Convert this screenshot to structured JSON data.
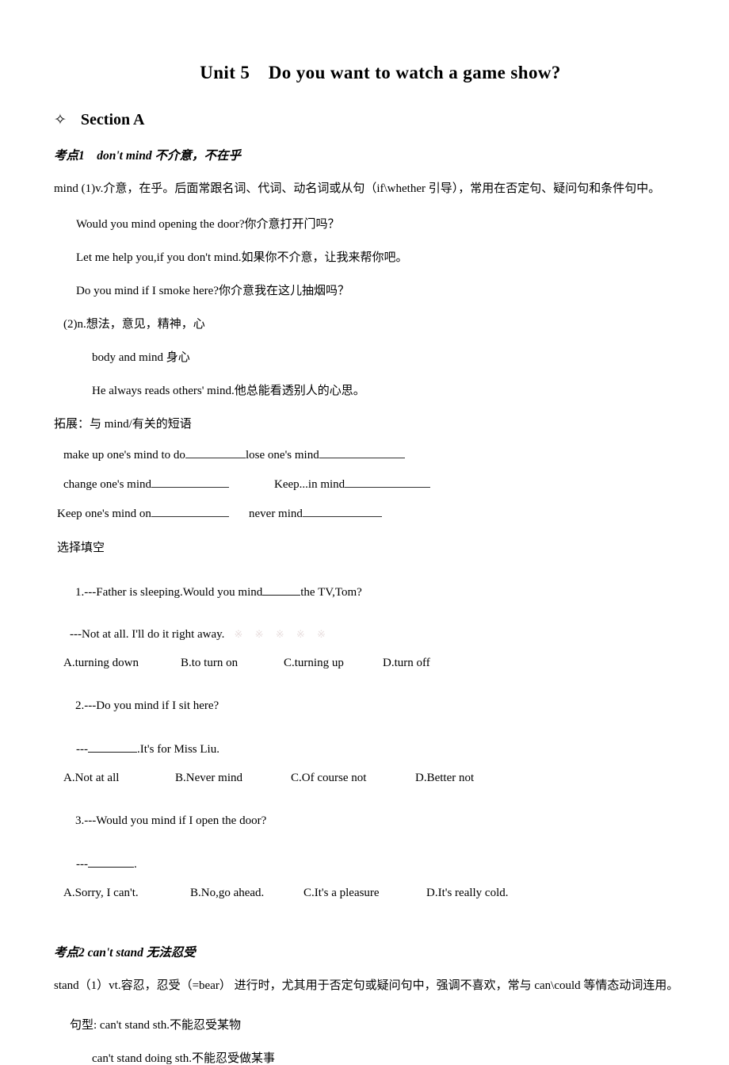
{
  "document": {
    "title": "Unit 5　Do you want to watch a game show?",
    "section_heading": {
      "bullet_icon": "diamond-star-icon",
      "bullet_glyph": "✧",
      "label": "Section A"
    }
  },
  "point1": {
    "heading": "考点1　don't mind 不介意，不在乎",
    "definition_1": "mind (1)v.介意，在乎。后面常跟名词、代词、动名词或从句（if\\whether 引导），常用在否定句、疑问句和条件句中。",
    "examples_1": [
      "Would you mind opening the door?你介意打开门吗？",
      "Let me help you,if you don't mind.如果你不介意，让我来帮你吧。",
      "Do you mind if I smoke here?你介意我在这儿抽烟吗？"
    ],
    "definition_2": "(2)n.想法，意见，精神，心",
    "examples_2": [
      "body and mind 身心",
      "He always reads others' mind.他总能看透别人的心思。"
    ],
    "expansion_label": "拓展：与 mind/有关的短语",
    "phrases": [
      {
        "left": "make up one's mind to do",
        "right": "lose one's mind"
      },
      {
        "left": "change one's mind",
        "right": "Keep...in mind"
      },
      {
        "left": "Keep one's mind on",
        "right": "never mind"
      }
    ],
    "exercise_label": "选择填空",
    "questions": [
      {
        "number": "1.",
        "prompt_before": "1.---Father is sleeping.Would you mind",
        "prompt_after": "the TV,Tom?",
        "answer_line": "---Not at all. I'll do it right away.",
        "watermark": "※ ※ ※ ※ ※",
        "options": [
          "A.turning down",
          "B.to turn on",
          "C.turning up",
          "D.turn off"
        ]
      },
      {
        "number": "2.",
        "prompt_before": "2.---Do you mind if I sit here?",
        "prompt_after": "",
        "answer_line_before": "---",
        "answer_line_after": ".It's for Miss Liu.",
        "options": [
          "A.Not at all",
          "B.Never mind",
          "C.Of course not",
          "D.Better not"
        ]
      },
      {
        "number": "3.",
        "prompt_before": "3.---Would you mind if I open the door?",
        "prompt_after": "",
        "answer_line_before": "---",
        "answer_line_after": ".",
        "options": [
          "A.Sorry, I can't.",
          "B.No,go ahead.",
          "C.It's a pleasure",
          "D.It's really cold."
        ]
      }
    ]
  },
  "point2": {
    "heading": "考点2 can't stand 无法忍受",
    "definition": "stand（1）vt.容忍，忍受（=bear） 进行时，尤其用于否定句或疑问句中，强调不喜欢，常与 can\\could 等情态动词连用。",
    "patterns": [
      "句型: can't stand sth.不能忍受某物",
      "can't stand doing sth.不能忍受做某事"
    ]
  }
}
